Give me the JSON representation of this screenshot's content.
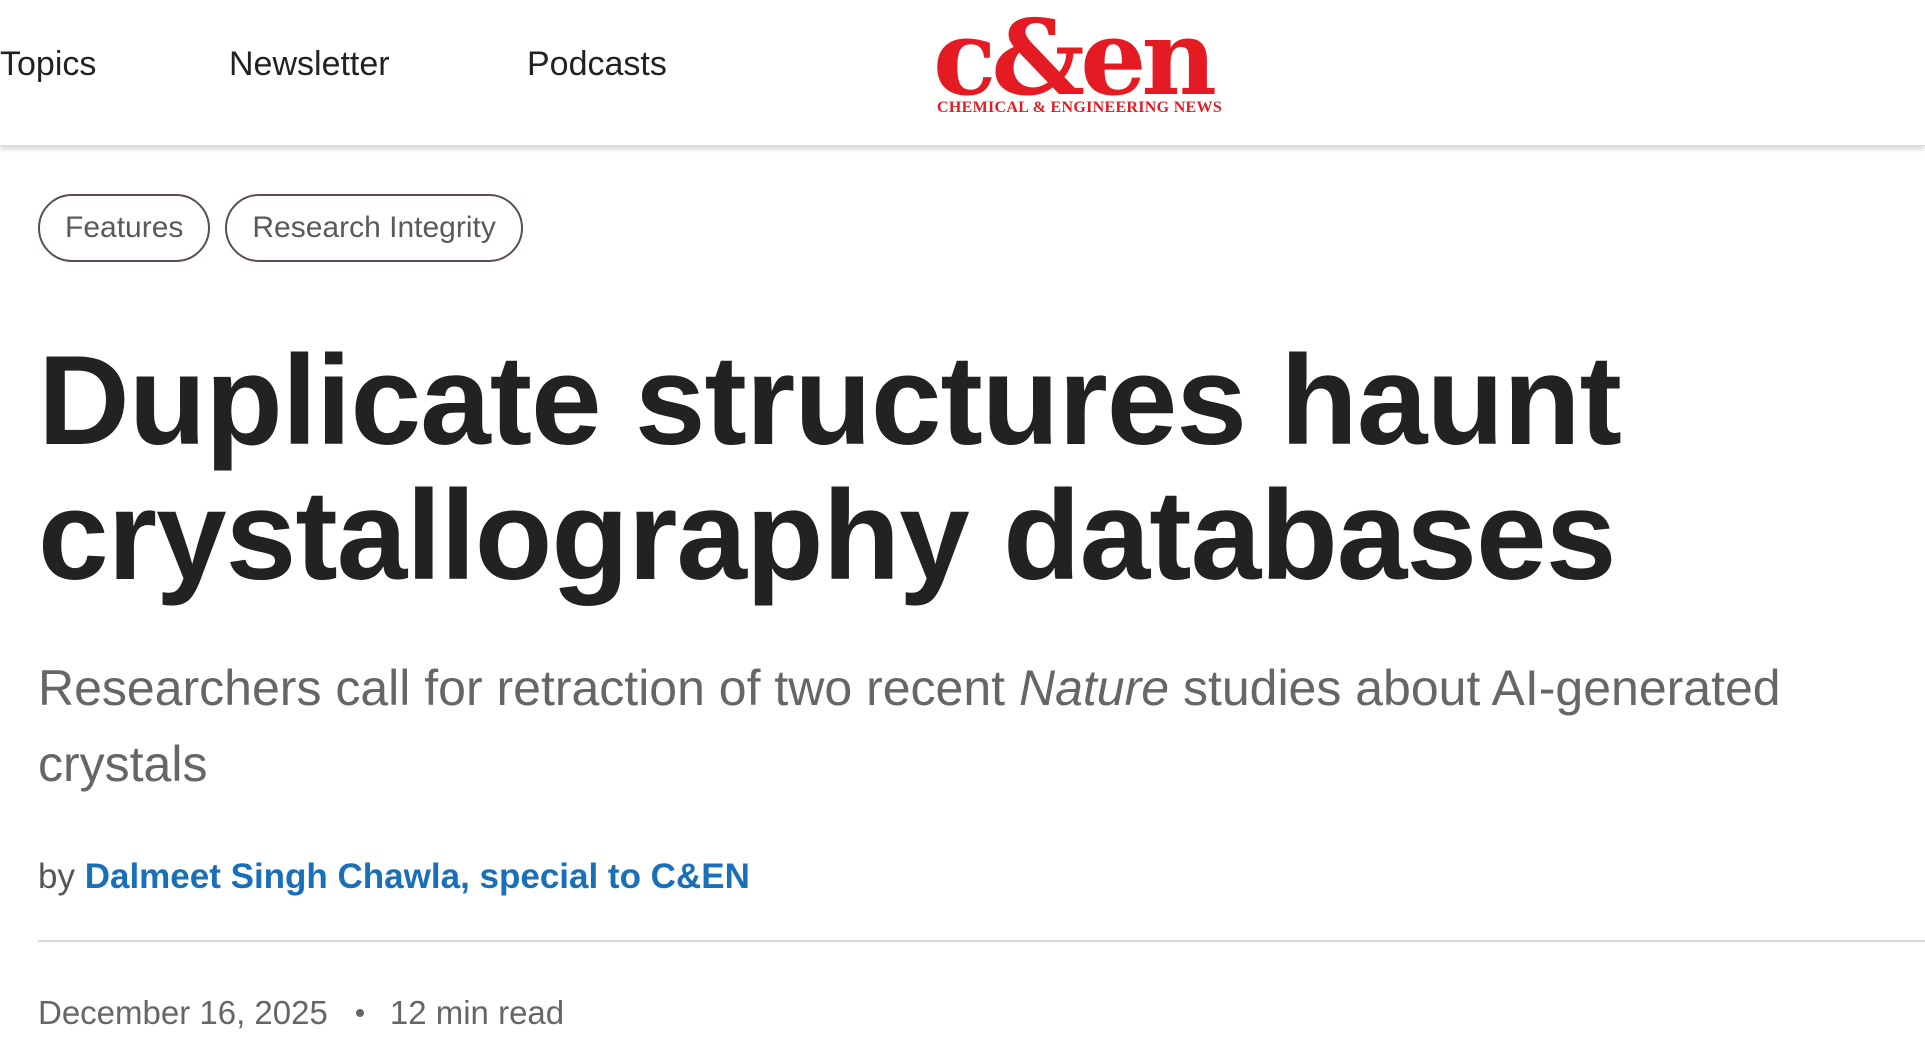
{
  "nav": {
    "items": [
      {
        "label": "Topics"
      },
      {
        "label": "Newsletter"
      },
      {
        "label": "Podcasts"
      }
    ]
  },
  "logo": {
    "wordmark": "c&en",
    "tagline": "CHEMICAL & ENGINEERING NEWS",
    "color": "#e41b23"
  },
  "article": {
    "tags": [
      {
        "label": "Features"
      },
      {
        "label": "Research Integrity"
      }
    ],
    "headline_line1": "Duplicate structures haunt",
    "headline_line2": "crystallography databases",
    "subhead_before": "Researchers call for retraction of two recent ",
    "subhead_italic": "Nature",
    "subhead_after": " studies about AI-generated crystals",
    "byline_prefix": "by",
    "author": "Dalmeet Singh Chawla, special to C&EN",
    "date": "December 16, 2025",
    "read_time": "12 min read"
  },
  "colors": {
    "brand_red": "#e41b23",
    "link_blue": "#1a6fb9",
    "text_dark": "#222222",
    "text_muted": "#666666"
  }
}
